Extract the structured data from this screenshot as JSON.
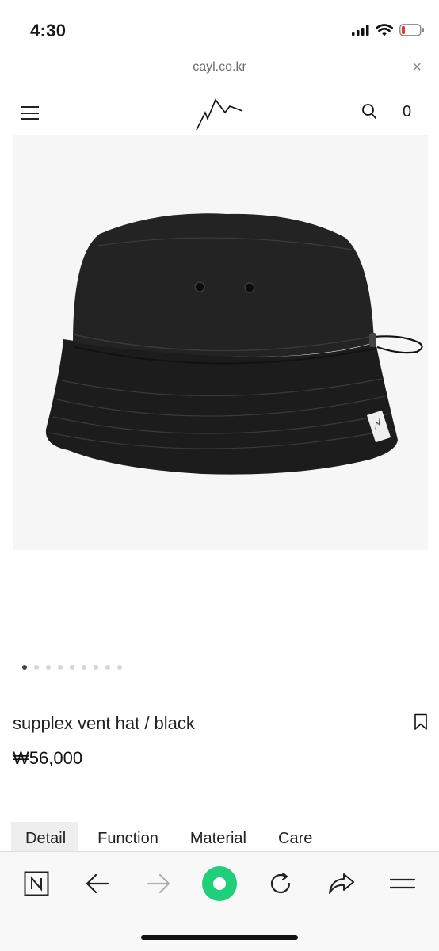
{
  "status_bar": {
    "time": "4:30"
  },
  "browser": {
    "url": "cayl.co.kr",
    "close_label": "×"
  },
  "header": {
    "cart_count": "0"
  },
  "gallery": {
    "image_count": 9,
    "active_index": 0
  },
  "product": {
    "name": "supplex vent hat / black",
    "price": "₩56,000"
  },
  "tabs": [
    {
      "label": "Detail",
      "active": true
    },
    {
      "label": "Function",
      "active": false
    },
    {
      "label": "Material",
      "active": false
    },
    {
      "label": "Care",
      "active": false
    }
  ],
  "toolbar": {
    "items": [
      "n-icon",
      "back-icon",
      "forward-icon",
      "home-icon",
      "refresh-icon",
      "share-icon",
      "menu-icon"
    ],
    "accent_color": "#1fd07a"
  }
}
